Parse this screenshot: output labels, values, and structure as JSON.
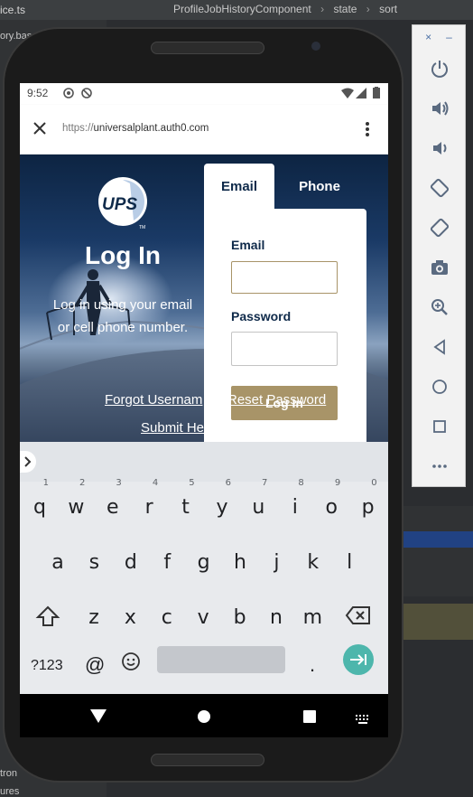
{
  "ide": {
    "file_tab": "ice.ts",
    "breadcrumb": [
      "ProfileJobHistoryComponent",
      "state",
      "sort"
    ],
    "side_texts": [
      "ory.base",
      "tron",
      "ures"
    ]
  },
  "emulator": {
    "close": "×",
    "minimize": "–",
    "buttons": [
      "power-icon",
      "volume-up-icon",
      "volume-down-icon",
      "rotate-left-icon",
      "rotate-right-icon",
      "camera-icon",
      "zoom-icon",
      "back-icon",
      "home-icon",
      "overview-icon",
      "more-icon"
    ]
  },
  "status_bar": {
    "time": "9:52"
  },
  "browser": {
    "url_prefix": "https://",
    "url_host": "universalplant.auth0.com"
  },
  "page": {
    "logo_text": "UPS",
    "title": "Log In",
    "subtitle_line1": "Log in using your email",
    "subtitle_line2": "or cell phone number.",
    "forgot_username": "Forgot Usernam",
    "separator": "|",
    "reset_password": "Reset Password",
    "submit_help": "Submit He",
    "tabs": [
      {
        "label": "Email",
        "active": true
      },
      {
        "label": "Phone",
        "active": false
      }
    ],
    "email_label": "Email",
    "email_value": "",
    "password_label": "Password",
    "password_value": "",
    "login_button": "Log In"
  },
  "keyboard": {
    "row1": [
      {
        "k": "q",
        "n": "1"
      },
      {
        "k": "w",
        "n": "2"
      },
      {
        "k": "e",
        "n": "3"
      },
      {
        "k": "r",
        "n": "4"
      },
      {
        "k": "t",
        "n": "5"
      },
      {
        "k": "y",
        "n": "6"
      },
      {
        "k": "u",
        "n": "7"
      },
      {
        "k": "i",
        "n": "8"
      },
      {
        "k": "o",
        "n": "9"
      },
      {
        "k": "p",
        "n": "0"
      }
    ],
    "row2": [
      "a",
      "s",
      "d",
      "f",
      "g",
      "h",
      "j",
      "k",
      "l"
    ],
    "row3": [
      "z",
      "x",
      "c",
      "v",
      "b",
      "n",
      "m"
    ],
    "symbols_key": "?123",
    "at_key": "@",
    "period_key": "."
  },
  "colors": {
    "accent_gold": "#a89468",
    "navy": "#0f2a4a",
    "keyboard_enter": "#4db6ac"
  }
}
